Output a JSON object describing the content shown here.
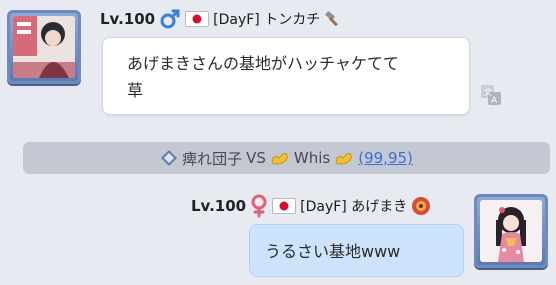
{
  "messages": [
    {
      "side": "left",
      "level": "Lv.100",
      "gender_icon": "male-symbol-icon",
      "flag": "japan-flag-icon",
      "name": "[DayF] トンカチ",
      "name_icon": "hammer-icon",
      "text_lines": [
        "あげまきさんの基地がハッチャケてて",
        "草"
      ],
      "avatar_icon": "anime-character-avatar"
    },
    {
      "side": "right",
      "level": "Lv.100",
      "gender_icon": "female-symbol-icon",
      "flag": "japan-flag-icon",
      "name": "[DayF] あげまき",
      "name_icon": "shrine-emblem-icon",
      "text_lines": [
        "うるさい基地www"
      ],
      "avatar_icon": "anime-girl-kimono-avatar"
    }
  ],
  "system": {
    "left_name": "痺れ団子",
    "vs": "VS",
    "right_name": "Whis",
    "link": "(99,95)"
  },
  "translate_icon": "translate-icon",
  "colors": {
    "background": "#e7eaf1",
    "bubble_left": "#ffffff",
    "bubble_right": "#cde3fb",
    "link": "#3d6fd6"
  }
}
